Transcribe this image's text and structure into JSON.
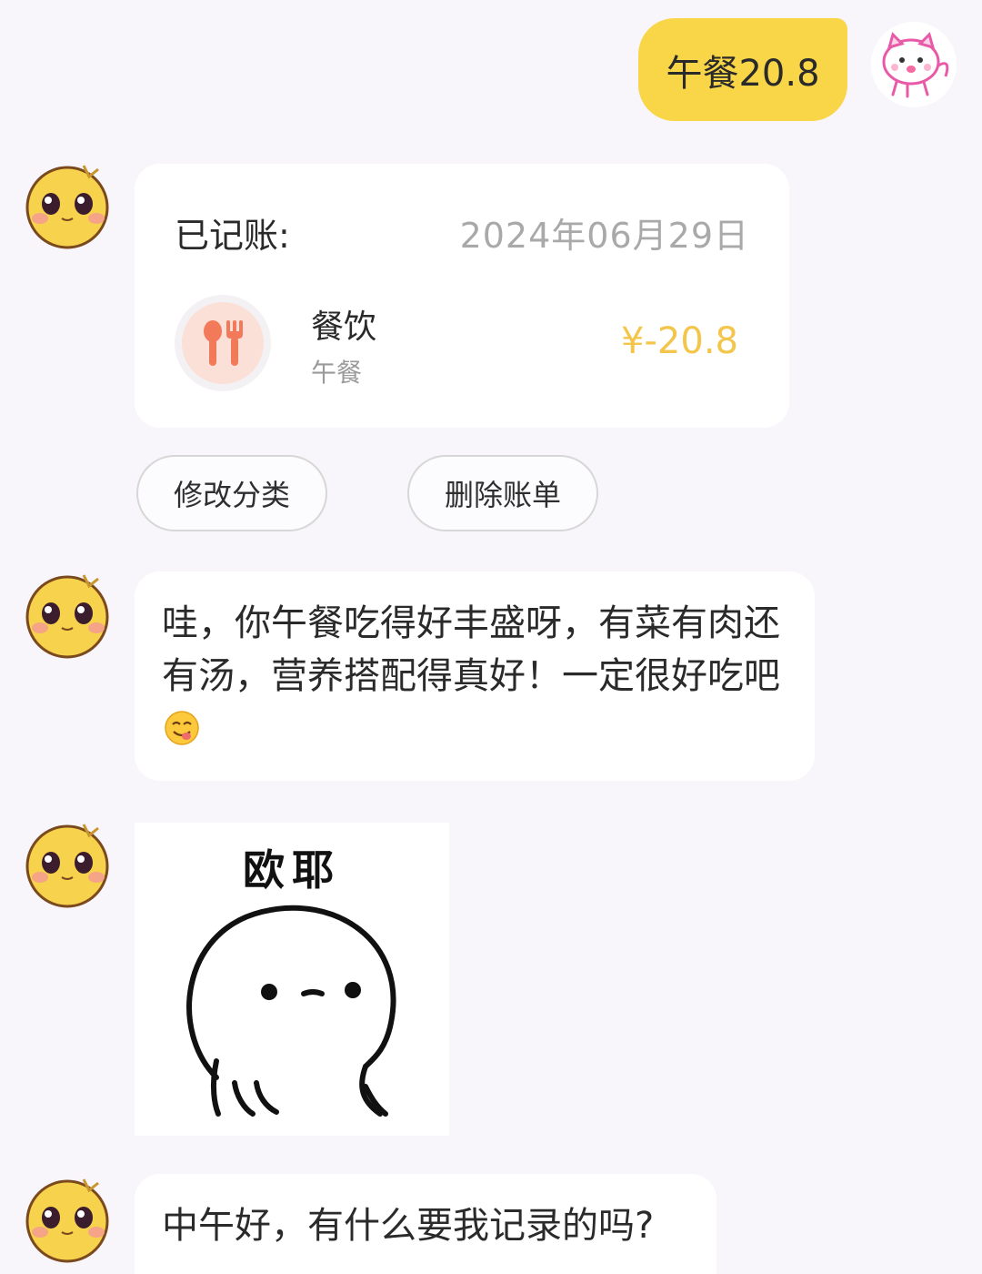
{
  "user": {
    "message": "午餐20.8",
    "avatar_icon": "pink-cat-avatar-icon"
  },
  "bot": {
    "avatar_icon": "yellow-emoji-avatar-icon"
  },
  "record_card": {
    "title": "已记账:",
    "date": "2024年06月29日",
    "category_icon": "fork-spoon-icon",
    "category": "餐饮",
    "note": "午餐",
    "amount": "¥-20.8"
  },
  "actions": {
    "edit_category": "修改分类",
    "delete_bill": "删除账单"
  },
  "messages": {
    "reply_1": "哇，你午餐吃得好丰盛呀，有菜有肉还有汤，营养搭配得真好！一定很好吃吧",
    "reply_1_emoji": "yum-face-emoji",
    "sticker_title": "欧耶",
    "reply_2": "中午好，有什么要我记录的吗?"
  },
  "colors": {
    "user_bubble": "#f9d548",
    "amount": "#f3c54a",
    "background": "#f8f6fa"
  }
}
